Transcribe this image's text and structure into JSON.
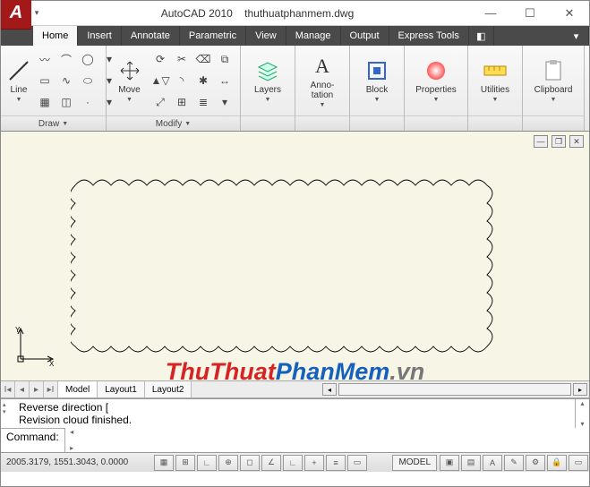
{
  "title": {
    "app": "AutoCAD 2010",
    "file": "thuthuatphanmem.dwg"
  },
  "tabs": {
    "items": [
      "Home",
      "Insert",
      "Annotate",
      "Parametric",
      "View",
      "Manage",
      "Output",
      "Express Tools"
    ],
    "active": 0
  },
  "ribbon": {
    "draw": {
      "title": "Draw",
      "line": "Line"
    },
    "modify": {
      "title": "Modify",
      "move": "Move"
    },
    "layers": "Layers",
    "annotation": "Anno-\ntation",
    "block": "Block",
    "properties": "Properties",
    "utilities": "Utilities",
    "clipboard": "Clipboard"
  },
  "layout_tabs": {
    "items": [
      "Model",
      "Layout1",
      "Layout2"
    ],
    "active": 0
  },
  "command": {
    "history": [
      "Reverse direction [",
      "Revision cloud finished."
    ],
    "prompt": "Command:"
  },
  "status": {
    "coords": "2005.3179, 1551.3043, 0.0000",
    "model": "MODEL"
  },
  "watermark": {
    "a": "ThuThuat",
    "b": "PhanMem",
    "c": ".vn"
  }
}
